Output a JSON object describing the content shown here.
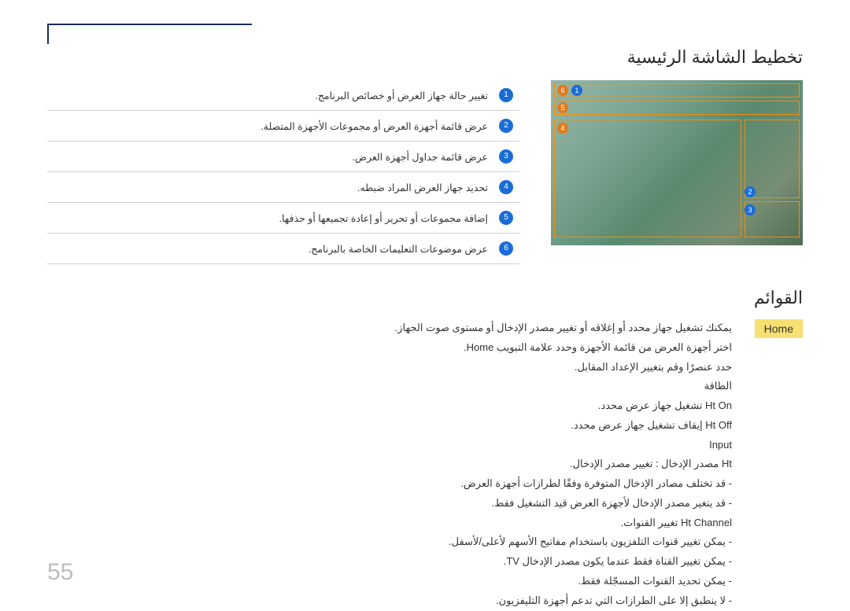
{
  "page_number": "55",
  "section_title": "تخطيط الشاشة الرئيسية",
  "legend": [
    {
      "num": "1",
      "text": "تغيير حالة جهاز العرض أو خصائص البرنامج."
    },
    {
      "num": "2",
      "text": "عرض قائمة أجهزة العرض أو مجموعات الأجهزة المتصلة."
    },
    {
      "num": "3",
      "text": "عرض قائمة جداول أجهزة العرض."
    },
    {
      "num": "4",
      "text": "تحديد جهاز العرض المراد ضبطه."
    },
    {
      "num": "5",
      "text": "إضافة مجموعات أو تحرير أو إعادة تجميعها أو حذفها."
    },
    {
      "num": "6",
      "text": "عرض موضوعات التعليمات الخاصة بالبرنامج."
    }
  ],
  "menus_title": "القوائم",
  "home_label": "Home",
  "menu_lines": [
    "يمكنك تشغيل جهاز محدد أو إغلاقه أو تغيير مصدر الإدخال أو مستوى صوت الجهاز.",
    "اختر أجهزة العرض من قائمة الأجهزة وحدد علامة التبويب Home.",
    "حدد عنصرًا وقم بتغيير الإعداد المقابل.",
    "الطاقة",
    "Ht   On  تشغيل جهاز عرض محدد.",
    "Ht   Off  إيقاف تشغيل جهاز عرض محدد.",
    "Input",
    "Ht   مصدر الإدخال : تغيير مصدر الإدخال.",
    "- قد تختلف مصادر الإدخال المتوفرة وفقًا لطرازات أجهزة العرض.",
    "- قد يتغير مصدر الإدخال لأجهزة العرض قيد التشغيل فقط.",
    "Ht   Channel  تغيير القنوات.",
    "- يمكن تغيير قنوات التلفزيون باستخدام مفاتيح الأسهم لأعلى/لأسفل.",
    "- يمكن تغيير القناة فقط عندما يكون مصدر الإدخال TV.",
    "- يمكن تحديد القنوات المسجّلة فقط.",
    "- لا ينطبق إلا على الطرازات التي تدعم أجهزة التليفزيون."
  ]
}
